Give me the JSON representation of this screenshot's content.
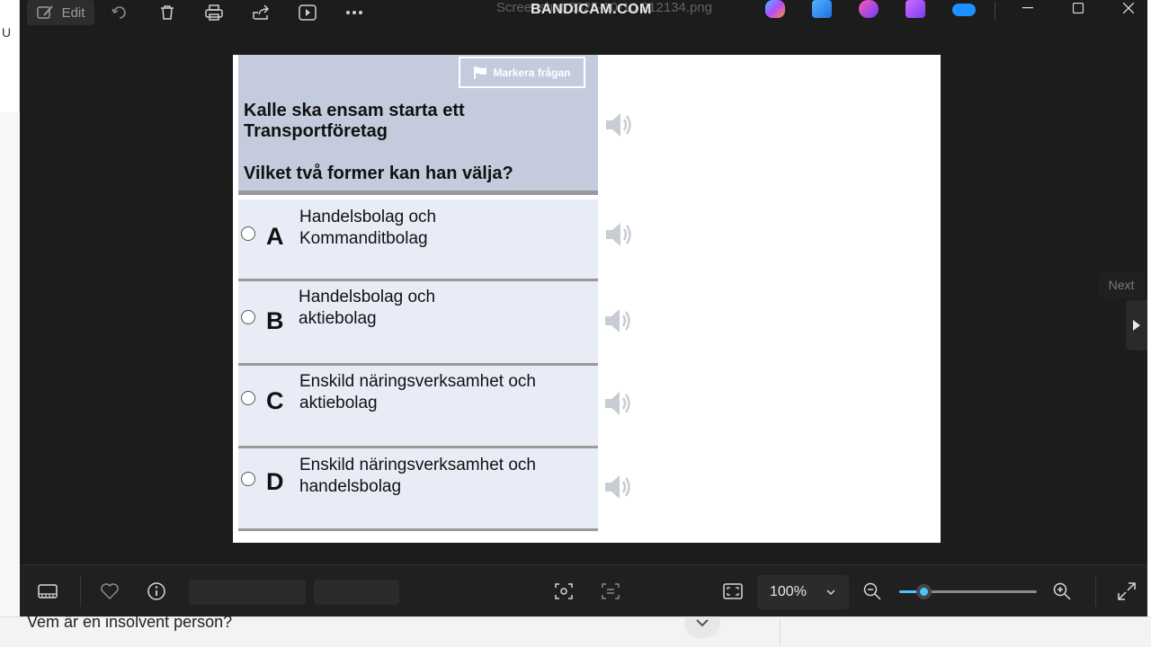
{
  "window": {
    "file_title": "Screenshot 2025-10-10 212134.png",
    "watermark": "BANDICAM.COM",
    "edit_label": "Edit"
  },
  "quiz": {
    "mark_button": "Markera frågan",
    "question_line1": "Kalle ska ensam starta ett",
    "question_line2": "Transportföretag",
    "question_line3": "Vilket två former kan han välja?",
    "options": [
      {
        "letter": "A",
        "line1": "Handelsbolag och",
        "line2": "Kommanditbolag"
      },
      {
        "letter": "B",
        "line1": "Handelsbolag och",
        "line2": "aktiebolag"
      },
      {
        "letter": "C",
        "line1": "Enskild näringsverksamhet och",
        "line2": "aktiebolag"
      },
      {
        "letter": "D",
        "line1": "Enskild näringsverksamhet och",
        "line2": "handelsbolag"
      }
    ]
  },
  "nav": {
    "next_label": "Next"
  },
  "toolbar": {
    "zoom_value": "100%",
    "zoom_level": 0.18
  },
  "background_page": {
    "question_text": "Vem är en insolvent person?",
    "left_char": "U"
  },
  "colors": {
    "viewer_bg": "#1c1c1c",
    "question_header": "#c3cbdc",
    "option_bg": "#e8ecf6",
    "accent": "#4cc2ff"
  }
}
